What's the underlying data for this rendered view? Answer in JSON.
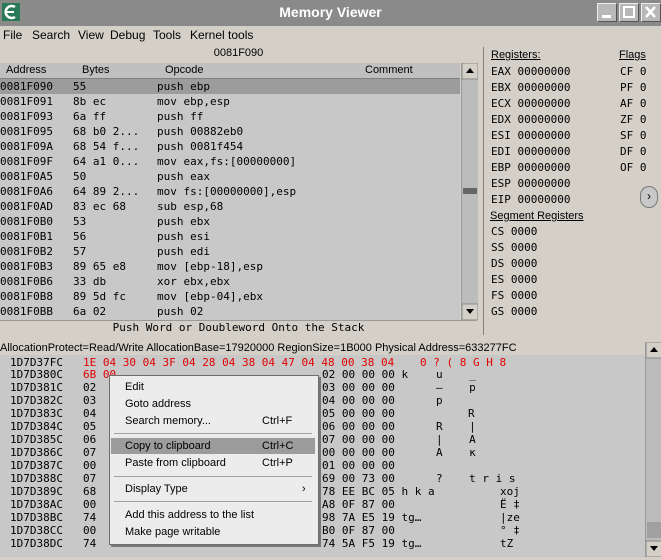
{
  "window": {
    "title": "Memory Viewer"
  },
  "menu": [
    "File",
    "Search",
    "View",
    "Debug",
    "Tools",
    "Kernel tools"
  ],
  "disassembler": {
    "current_address": "0081F090",
    "columns": {
      "address": "Address",
      "bytes": "Bytes",
      "opcode": "Opcode",
      "comment": "Comment"
    },
    "rows": [
      {
        "address": "0081F090",
        "bytes": "55",
        "opcode": "push ebp"
      },
      {
        "address": "0081F091",
        "bytes": "8b ec",
        "opcode": "mov ebp,esp"
      },
      {
        "address": "0081F093",
        "bytes": "6a ff",
        "opcode": "push ff"
      },
      {
        "address": "0081F095",
        "bytes": "68 b0 2...",
        "opcode": "push 00882eb0"
      },
      {
        "address": "0081F09A",
        "bytes": "68 54 f...",
        "opcode": "push 0081f454"
      },
      {
        "address": "0081F09F",
        "bytes": "64 a1 0...",
        "opcode": "mov eax,fs:[00000000]"
      },
      {
        "address": "0081F0A5",
        "bytes": "50",
        "opcode": "push eax"
      },
      {
        "address": "0081F0A6",
        "bytes": "64 89 2...",
        "opcode": "mov fs:[00000000],esp"
      },
      {
        "address": "0081F0AD",
        "bytes": "83 ec 68",
        "opcode": "sub esp,68"
      },
      {
        "address": "0081F0B0",
        "bytes": "53",
        "opcode": "push ebx"
      },
      {
        "address": "0081F0B1",
        "bytes": "56",
        "opcode": "push esi"
      },
      {
        "address": "0081F0B2",
        "bytes": "57",
        "opcode": "push edi"
      },
      {
        "address": "0081F0B3",
        "bytes": "89 65 e8",
        "opcode": "mov [ebp-18],esp"
      },
      {
        "address": "0081F0B6",
        "bytes": "33 db",
        "opcode": "xor ebx,ebx"
      },
      {
        "address": "0081F0B8",
        "bytes": "89 5d fc",
        "opcode": "mov [ebp-04],ebx"
      },
      {
        "address": "0081F0BB",
        "bytes": "6a 02",
        "opcode": "push 02"
      }
    ],
    "status": "Push Word or Doubleword Onto the Stack"
  },
  "registers": {
    "header": "Registers:",
    "items": [
      {
        "name": "EAX",
        "value": "00000000"
      },
      {
        "name": "EBX",
        "value": "00000000"
      },
      {
        "name": "ECX",
        "value": "00000000"
      },
      {
        "name": "EDX",
        "value": "00000000"
      },
      {
        "name": "ESI",
        "value": "00000000"
      },
      {
        "name": "EDI",
        "value": "00000000"
      },
      {
        "name": "EBP",
        "value": "00000000"
      },
      {
        "name": "ESP",
        "value": "00000000"
      },
      {
        "name": "EIP",
        "value": "00000000"
      }
    ],
    "flags_header": "Flags",
    "flags": [
      {
        "name": "CF",
        "value": "0"
      },
      {
        "name": "PF",
        "value": "0"
      },
      {
        "name": "AF",
        "value": "0"
      },
      {
        "name": "ZF",
        "value": "0"
      },
      {
        "name": "SF",
        "value": "0"
      },
      {
        "name": "DF",
        "value": "0"
      },
      {
        "name": "OF",
        "value": "0"
      }
    ],
    "segment_header": "Segment Registers",
    "segments": [
      {
        "name": "CS",
        "value": "0000"
      },
      {
        "name": "SS",
        "value": "0000"
      },
      {
        "name": "DS",
        "value": "0000"
      },
      {
        "name": "ES",
        "value": "0000"
      },
      {
        "name": "FS",
        "value": "0000"
      },
      {
        "name": "GS",
        "value": "0000"
      }
    ],
    "nav_symbol": "›"
  },
  "hexview": {
    "info": "AllocationProtect=Read/Write AllocationBase=17920000 RegionSize=1B000 Physical Address=633277FC",
    "rows": [
      {
        "address": "1D7D37FC",
        "left": "1E 04 30 04 3F 04 28 04 38 04 47 04 48 00 38 04",
        "ascii": "0 ? ( 8 G H 8",
        "red": true
      },
      {
        "address": "1D7D380C",
        "left": "6B 00",
        "right": "02 00 00 00 k",
        "ascii": "u    _",
        "partial_red": true
      },
      {
        "address": "1D7D381C",
        "left": "02",
        "right": "03 00 00 00",
        "ascii": "–    p"
      },
      {
        "address": "1D7D382C",
        "left": "03",
        "right": "04 00 00 00",
        "ascii": "p"
      },
      {
        "address": "1D7D383C",
        "left": "04",
        "right": "05 00 00 00",
        "ascii": "R"
      },
      {
        "address": "1D7D384C",
        "left": "05",
        "right": "06 00 00 00",
        "ascii": "R    |"
      },
      {
        "address": "1D7D385C",
        "left": "06",
        "right": "07 00 00 00",
        "ascii": "|    A"
      },
      {
        "address": "1D7D386C",
        "left": "07",
        "right": "00 00 00 00",
        "ascii": "A    к"
      },
      {
        "address": "1D7D387C",
        "left": "00",
        "right": "01 00 00 00",
        "ascii": ""
      },
      {
        "address": "1D7D388C",
        "left": "07",
        "right": "69 00 73 00",
        "ascii": "?    t r i s"
      },
      {
        "address": "1D7D389C",
        "left": "68",
        "right": "78 EE BC 05 h k a",
        "ascii": "xoj"
      },
      {
        "address": "1D7D38AC",
        "left": "00",
        "right": "A8 0F 87 00",
        "ascii": "Ё ‡"
      },
      {
        "address": "1D7D38BC",
        "left": "74",
        "right": "98 7A E5 19 tg…",
        "ascii": "|ze"
      },
      {
        "address": "1D7D38CC",
        "left": "00",
        "right": "B0 0F 87 00",
        "ascii": "° ‡"
      },
      {
        "address": "1D7D38DC",
        "left": "74",
        "right": "74 5A F5 19 tg…",
        "ascii": "tZ"
      }
    ]
  },
  "context_menu": {
    "items": [
      {
        "label": "Edit",
        "shortcut": ""
      },
      {
        "label": "Goto address",
        "shortcut": ""
      },
      {
        "label": "Search memory...",
        "shortcut": "Ctrl+F"
      },
      {
        "label": "Copy to clipboard",
        "shortcut": "Ctrl+C"
      },
      {
        "label": "Paste from clipboard",
        "shortcut": "Ctrl+P"
      },
      {
        "label": "Display Type",
        "shortcut": "›"
      },
      {
        "label": "Add this address to the list",
        "shortcut": ""
      },
      {
        "label": "Make page writable",
        "shortcut": ""
      }
    ]
  },
  "colors": {
    "title_bg": "#8a8a8a",
    "panel_bg": "#c8c8c8",
    "selection": "#9c9c9c",
    "highlight_text": "#e00000"
  }
}
